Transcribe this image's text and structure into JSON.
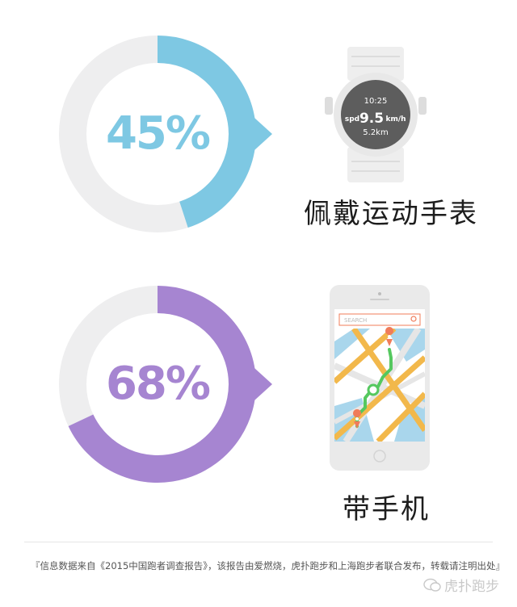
{
  "chart_data": [
    {
      "type": "pie",
      "subtype": "donut",
      "value_percent": 45,
      "label": "45%",
      "category": "佩戴运动手表",
      "color": "#7ec8e3",
      "track_color": "#eeeeef"
    },
    {
      "type": "pie",
      "subtype": "donut",
      "value_percent": 68,
      "label": "68%",
      "category": "带手机",
      "color": "#a685d1",
      "track_color": "#eeeeef"
    }
  ],
  "watch": {
    "time": "10:25",
    "spd_label": "spd",
    "speed": "9.5",
    "speed_unit": "km/h",
    "distance": "5.2km"
  },
  "phone": {
    "search_placeholder": "SEARCH"
  },
  "footer": {
    "note": "『信息数据来自《2015中国跑者调查报告》，该报告由爱燃烧，虎扑跑步和上海跑步者联合发布，转载请注明出处』",
    "brand": "虎扑跑步"
  }
}
